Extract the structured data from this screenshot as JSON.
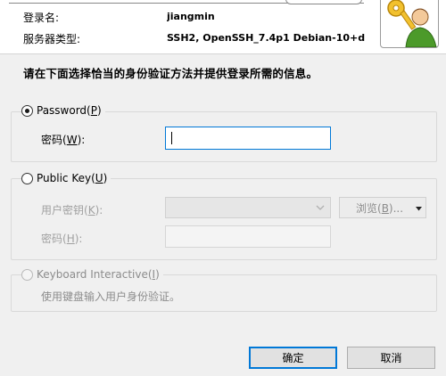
{
  "header": {
    "username_label": "登录名:",
    "username_value": "jiangmin",
    "server_type_label": "服务器类型:",
    "server_type_value": "SSH2, OpenSSH_7.4p1 Debian-10+d"
  },
  "instruction": "请在下面选择恰当的身份验证方法并提供登录所需的信息。",
  "password_method": {
    "label": "Password(",
    "accel": "P",
    "suffix": ")",
    "selected": true,
    "password_field_label": "密码(",
    "password_field_accel": "W",
    "password_field_suffix": "):",
    "password_value": ""
  },
  "publickey_method": {
    "label": "Public Key(",
    "accel": "U",
    "suffix": ")",
    "selected": false,
    "user_key_label": "用户密钥(",
    "user_key_accel": "K",
    "user_key_suffix": "):",
    "user_key_value": "",
    "browse_label": "浏览(",
    "browse_accel": "B",
    "browse_suffix": ")...",
    "passphrase_label": "密码(",
    "passphrase_accel": "H",
    "passphrase_suffix": "):",
    "passphrase_value": ""
  },
  "keyboard_method": {
    "label": "Keyboard Interactive(",
    "accel": "I",
    "suffix": ")",
    "selected": false,
    "description": "使用键盘输入用户身份验证。"
  },
  "buttons": {
    "ok": "确定",
    "cancel": "取消"
  },
  "colors": {
    "accent": "#0078d7",
    "dialog_bg": "#f0f0f0",
    "disabled_text": "#8c8c8c"
  },
  "icons": {
    "header_icon": "user-with-keys-icon",
    "dropdown": "chevron-down-icon",
    "split_arrow": "caret-down-icon"
  }
}
